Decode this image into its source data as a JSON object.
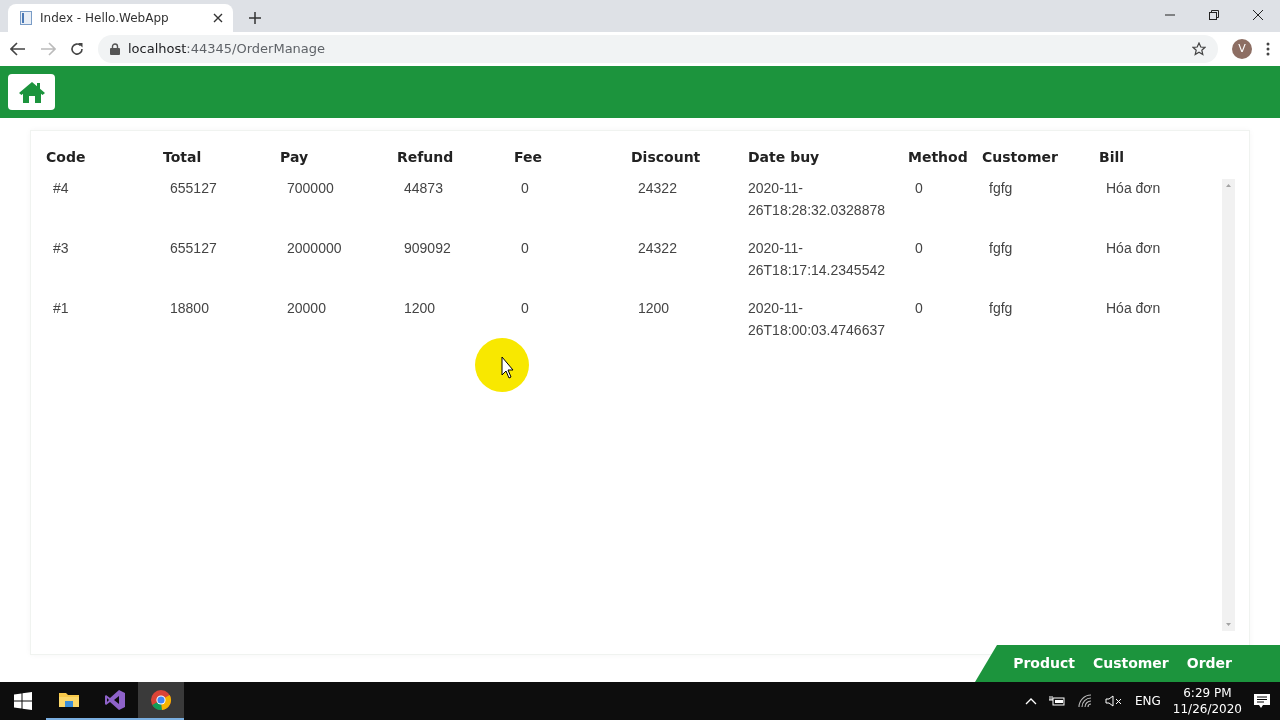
{
  "browser": {
    "tabs": [
      {
        "title": "Index - Hello.WebApp",
        "selected": true
      }
    ],
    "address": {
      "host": "localhost",
      "path": ":44345/OrderManage"
    },
    "forward_disabled": true,
    "profile_initial": "V"
  },
  "table": {
    "columns": [
      "Code",
      "Total",
      "Pay",
      "Refund",
      "Fee",
      "Discount",
      "Date buy",
      "Method",
      "Customer",
      "Bill"
    ],
    "rows": [
      [
        "#4",
        "655127",
        "700000",
        "44873",
        "0",
        "24322",
        "2020-11-26T18:28:32.0328878",
        "0",
        "fgfg",
        "Hóa đơn"
      ],
      [
        "#3",
        "655127",
        "2000000",
        "909092",
        "0",
        "24322",
        "2020-11-26T18:17:14.2345542",
        "0",
        "fgfg",
        "Hóa đơn"
      ],
      [
        "#1",
        "18800",
        "20000",
        "1200",
        "0",
        "1200",
        "2020-11-26T18:00:03.4746637",
        "0",
        "fgfg",
        "Hóa đơn"
      ]
    ]
  },
  "footer_nav": [
    {
      "label": "Product"
    },
    {
      "label": "Customer"
    },
    {
      "label": "Order"
    }
  ],
  "taskbar": {
    "apps": [
      {
        "kind": "folder",
        "selected": false
      },
      {
        "kind": "studio",
        "selected": false
      },
      {
        "kind": "browser",
        "selected": true
      }
    ],
    "language": "ENG",
    "time": "6:29 PM",
    "date": "11/26/2020"
  }
}
